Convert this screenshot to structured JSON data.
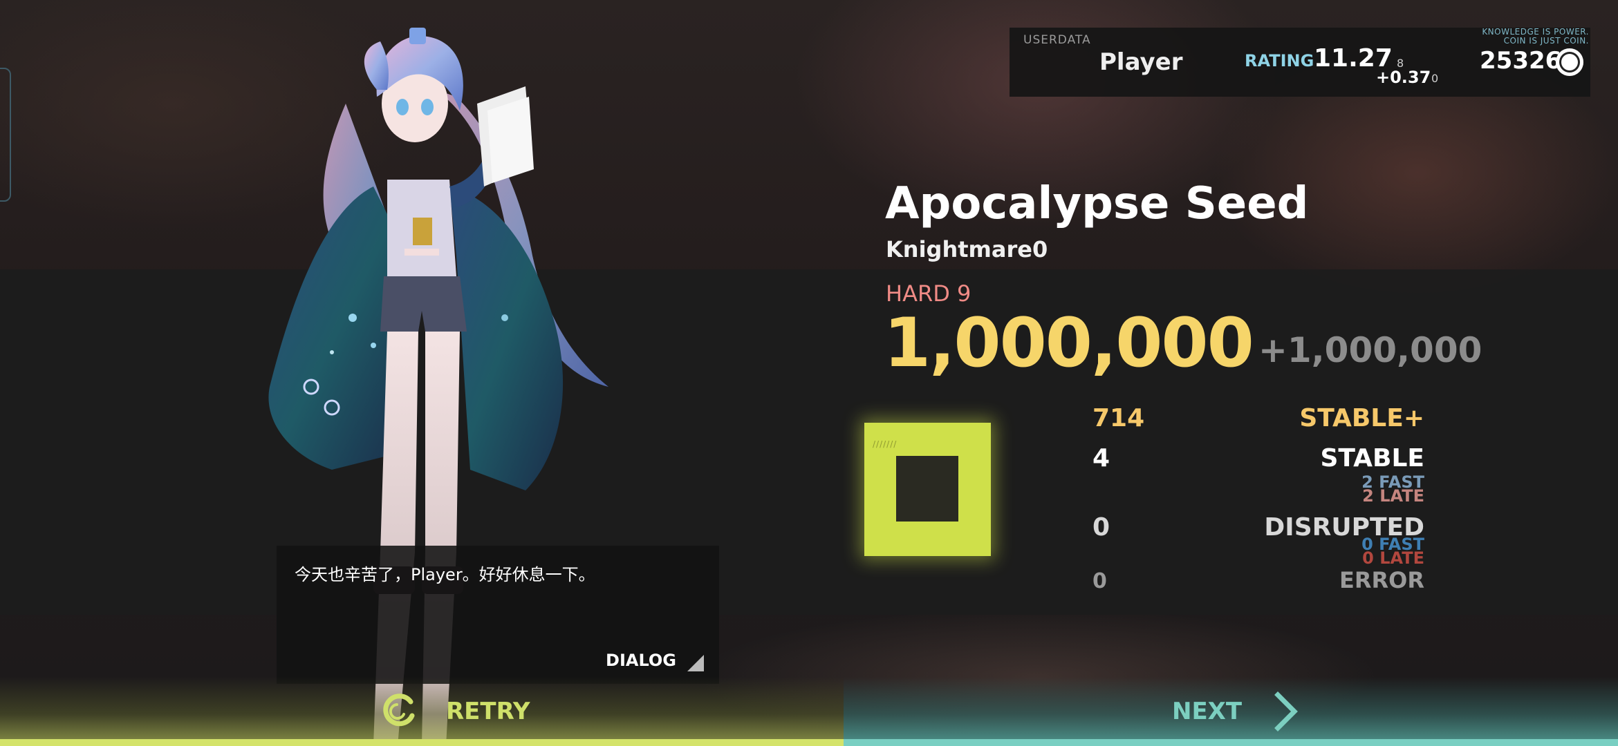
{
  "userdata": {
    "label": "USERDATA",
    "player": "Player",
    "rating_label": "RATING",
    "rating_value": "11.27",
    "rating_small": "8",
    "rating_delta": "+0.37",
    "rating_delta_small": "0",
    "motto_line1": "KNOWLEDGE IS POWER.",
    "motto_line2": "COIN IS JUST COIN.",
    "coins": "25326"
  },
  "song": {
    "title": "Apocalypse Seed",
    "artist": "Knightmare0",
    "difficulty": "HARD 9",
    "score": "1,000,000",
    "score_delta": "+1,000,000"
  },
  "stats": {
    "stable_plus": {
      "count": "714",
      "label": "STABLE+"
    },
    "stable": {
      "count": "4",
      "label": "STABLE",
      "fast": "2 FAST",
      "late": "2 LATE"
    },
    "disrupted": {
      "count": "0",
      "label": "DISRUPTED",
      "fast": "0 FAST",
      "late": "0 LATE"
    },
    "error": {
      "count": "0",
      "label": "ERROR"
    }
  },
  "dialog": {
    "text": "今天也辛苦了，Player。好好休息一下。",
    "label": "DIALOG"
  },
  "buttons": {
    "retry": "RETRY",
    "next": "NEXT"
  },
  "colors": {
    "score": "#f6d56a",
    "stable_plus": "#f6c86a",
    "difficulty": "#f08b86",
    "grade": "#cfe04a",
    "retry_accent": "#d4e36a",
    "next_accent": "#79cfc2",
    "fast": "#7a9bb8",
    "late": "#c5857f"
  }
}
